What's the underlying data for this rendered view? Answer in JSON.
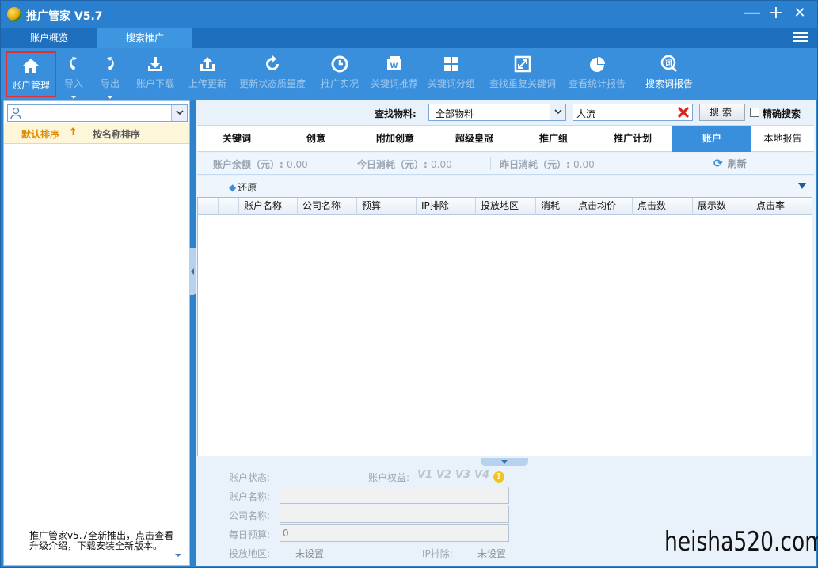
{
  "app": {
    "title": "推广管家 V5.7",
    "accent": "#2a7fcf",
    "toolbar_bg": "#3a8fdc",
    "selected_outline": "#e03030"
  },
  "window_controls": {
    "minimize": "—",
    "maximize": "+",
    "close": "✕"
  },
  "main_tabs": [
    {
      "label": "账户概览",
      "active": false
    },
    {
      "label": "搜索推广",
      "active": true
    }
  ],
  "toolbar": {
    "items": [
      {
        "label": "账户管理",
        "icon": "home-icon",
        "enabled": true,
        "selected": true
      },
      {
        "label": "导入",
        "icon": "undo-arrow-icon",
        "enabled": false,
        "dropdown": true
      },
      {
        "label": "导出",
        "icon": "redo-arrow-icon",
        "enabled": false,
        "dropdown": true
      },
      {
        "label": "账户下载",
        "icon": "download-icon",
        "enabled": false
      },
      {
        "label": "上传更新",
        "icon": "upload-icon",
        "enabled": false
      },
      {
        "label": "更新状态质量度",
        "icon": "refresh-icon",
        "enabled": false
      },
      {
        "label": "推广实况",
        "icon": "clock-icon",
        "enabled": false
      },
      {
        "label": "关键词推荐",
        "icon": "keyword-recommend-icon",
        "enabled": false
      },
      {
        "label": "关键词分组",
        "icon": "grid-group-icon",
        "enabled": false
      },
      {
        "label": "查找重复关键词",
        "icon": "find-duplicate-icon",
        "enabled": false
      },
      {
        "label": "查看统计报告",
        "icon": "pie-chart-icon",
        "enabled": false
      },
      {
        "label": "搜索词报告",
        "icon": "search-term-icon",
        "enabled": true
      }
    ]
  },
  "left_panel": {
    "search_placeholder": "",
    "sort_default": "默认排序",
    "sort_default_arrow": "↑",
    "sort_by_name": "按名称排序",
    "notice": "推广管家v5.7全新推出，点击查看升级介绍，下载安装全新版本。"
  },
  "filter": {
    "label": "查找物料:",
    "material_select": "全部物料",
    "keyword_value": "人流",
    "search_button": "搜索",
    "exact_label": "精确搜索",
    "exact_checked": false
  },
  "sub_tabs": [
    {
      "label": "关键词",
      "active": false
    },
    {
      "label": "创意",
      "active": false
    },
    {
      "label": "附加创意",
      "active": false
    },
    {
      "label": "超级皇冠",
      "active": false
    },
    {
      "label": "推广组",
      "active": false
    },
    {
      "label": "推广计划",
      "active": false
    },
    {
      "label": "账户",
      "active": true
    },
    {
      "label": "本地报告",
      "active": false
    }
  ],
  "stats": {
    "balance_label": "账户余额（元）:",
    "balance_value": "0.00",
    "today_label": "今日消耗（元）:",
    "today_value": "0.00",
    "yesterday_label": "昨日消耗（元）:",
    "yesterday_value": "0.00",
    "refresh_label": "刷新"
  },
  "restore_label": "还原",
  "table": {
    "columns": [
      "账户名称",
      "公司名称",
      "预算",
      "IP排除",
      "投放地区",
      "消耗",
      "点击均价",
      "点击数",
      "展示数",
      "点击率"
    ],
    "rows": []
  },
  "detail": {
    "status_label": "账户状态:",
    "rights_label": "账户权益:",
    "rights_badges": [
      "V1",
      "V2",
      "V3",
      "V4"
    ],
    "help": "?",
    "name_label": "账户名称:",
    "name_value": "",
    "company_label": "公司名称:",
    "company_value": "",
    "budget_label": "每日预算:",
    "budget_value": "0",
    "region_label": "投放地区:",
    "region_value": "未设置",
    "ip_label": "IP排除:",
    "ip_value": "未设置"
  },
  "watermark": "heisha520.com"
}
